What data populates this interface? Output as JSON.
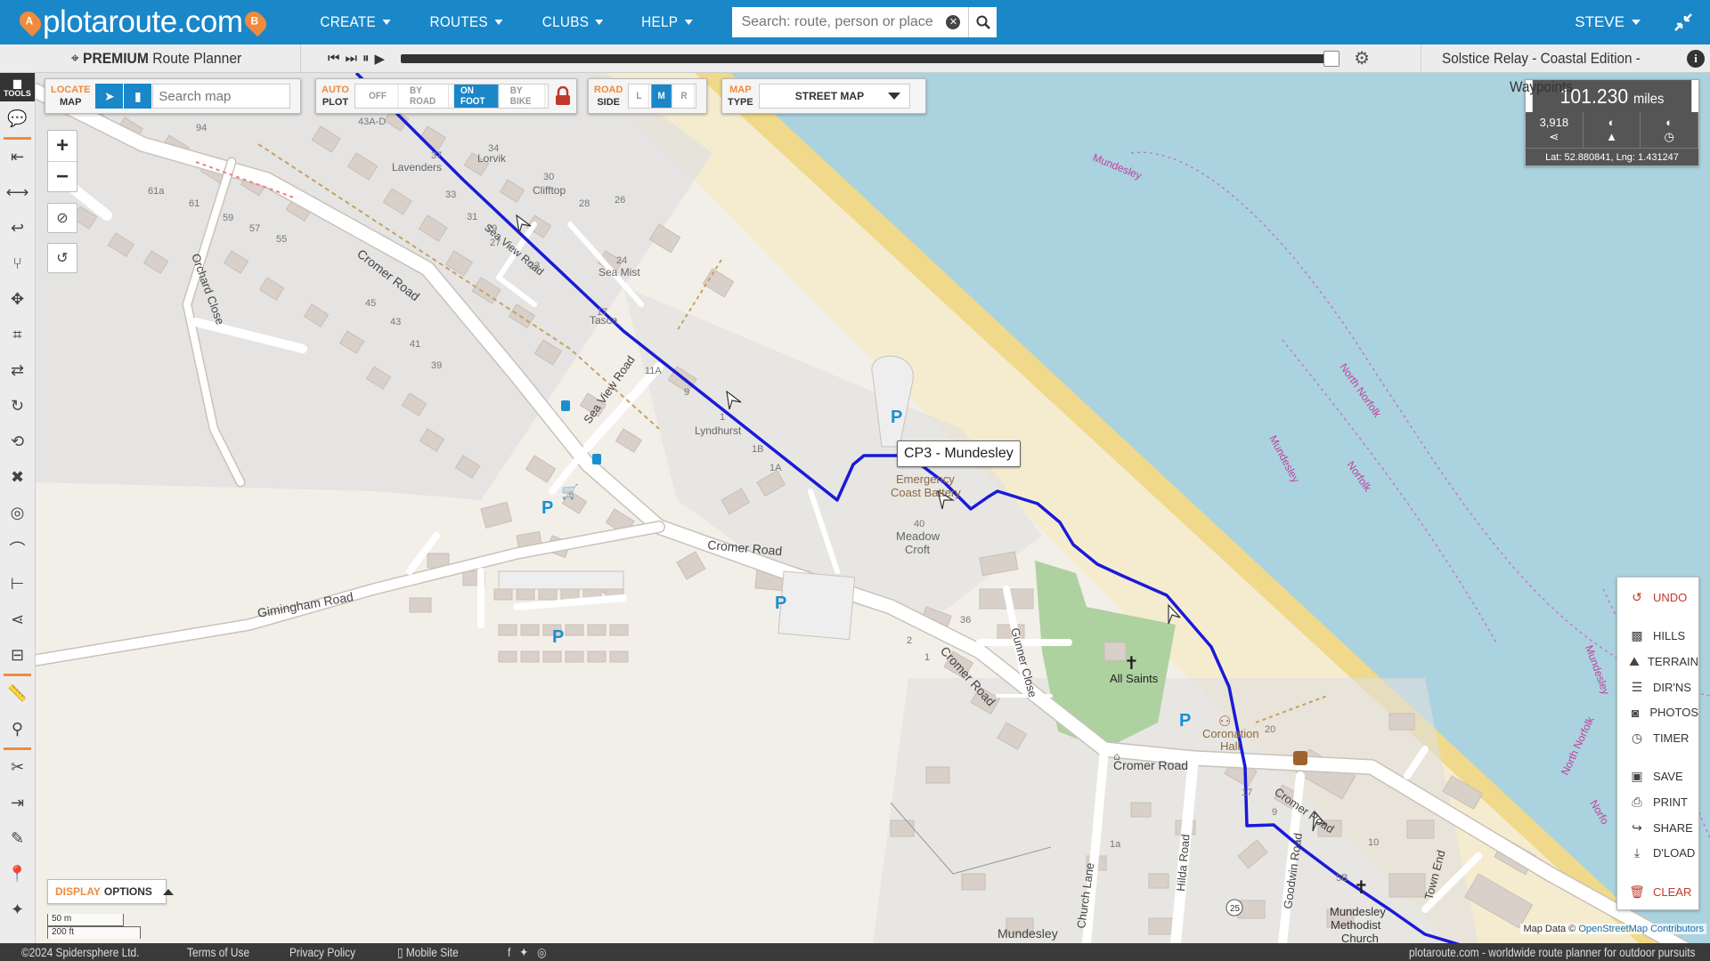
{
  "topbar": {
    "logo_text": "plotaroute.com",
    "pin_a": "A",
    "pin_b": "B",
    "menu": [
      {
        "label": "CREATE"
      },
      {
        "label": "ROUTES"
      },
      {
        "label": "CLUBS"
      },
      {
        "label": "HELP"
      }
    ],
    "search_placeholder": "Search: route, person or place",
    "user": "STEVE"
  },
  "subbar": {
    "planner_bold": "PREMIUM",
    "planner_rest": " Route Planner",
    "route_name": "Solstice Relay - Coastal Edition - Waypoints",
    "progress": 1.0
  },
  "tools": {
    "header": "TOOLS"
  },
  "locate": {
    "label1": "LOCATE",
    "label2": "MAP",
    "search_placeholder": "Search map"
  },
  "autoplot": {
    "label1": "AUTO",
    "label2": "PLOT",
    "options": [
      {
        "label": "OFF",
        "on": false
      },
      {
        "label": "BY ROAD",
        "on": false
      },
      {
        "label": "ON FOOT",
        "on": true
      },
      {
        "label": "BY BIKE",
        "on": false
      }
    ]
  },
  "roadside": {
    "label1": "ROAD",
    "label2": "SIDE",
    "options": [
      {
        "label": "L",
        "on": false
      },
      {
        "label": "M",
        "on": true
      },
      {
        "label": "R",
        "on": false
      }
    ]
  },
  "maptype": {
    "label1": "MAP",
    "label2": "TYPE",
    "selected": "STREET MAP"
  },
  "distance": {
    "value": "101.230",
    "unit": "miles",
    "count": "3,918",
    "latlng": "Lat: 52.880841, Lng: 1.431247"
  },
  "actions": [
    {
      "label": "UNDO",
      "icon": "undo-icon"
    },
    {
      "label": "HILLS",
      "icon": "hills-icon"
    },
    {
      "label": "TERRAIN",
      "icon": "terrain-icon"
    },
    {
      "label": "DIR'NS",
      "icon": "directions-icon"
    },
    {
      "label": "PHOTOS",
      "icon": "camera-icon"
    },
    {
      "label": "TIMER",
      "icon": "timer-icon"
    },
    {
      "label": "SAVE",
      "icon": "save-icon"
    },
    {
      "label": "PRINT",
      "icon": "print-icon"
    },
    {
      "label": "SHARE",
      "icon": "share-icon"
    },
    {
      "label": "D'LOAD",
      "icon": "download-icon"
    },
    {
      "label": "CLEAR",
      "icon": "trash-icon"
    }
  ],
  "display_options": {
    "orange": "DISPLAY",
    "rest": "OPTIONS"
  },
  "scale": {
    "metric": "50 m",
    "imperial": "200 ft"
  },
  "attribution": {
    "prefix": "Map Data ©",
    "link": "OpenStreetMap Contributors"
  },
  "checkpoint": "CP3 - Mundesley",
  "map_labels": {
    "roads": [
      "Cromer Road",
      "Cromer Road",
      "Cromer Road",
      "Cromer Road",
      "Cromer Road",
      "Gimingham Road",
      "Orchard Close",
      "Sea View Road",
      "Sea View Road",
      "Gunner Close",
      "Hilda Road",
      "Church Lane",
      "Goodwin Road",
      "Town End",
      "Mundesley"
    ],
    "places": [
      "Lavenders",
      "Lorvik",
      "Clifftop",
      "Sea Mist",
      "Tasca",
      "Lyndhurst",
      "Emergency",
      "Coast Battery",
      "Meadow",
      "Croft",
      "All Saints",
      "Coronation",
      "Hall",
      "Mundesley",
      "Methodist",
      "Church"
    ],
    "houses": [
      "94",
      "61a",
      "61",
      "59",
      "57",
      "55",
      "45",
      "43",
      "41",
      "39",
      "37",
      "34",
      "33",
      "31",
      "30",
      "29",
      "28",
      "27",
      "26",
      "24",
      "23",
      "17",
      "11A",
      "9",
      "1",
      "1B",
      "1A",
      "40",
      "36",
      "2",
      "1",
      "20",
      "17",
      "9",
      "10",
      "5B",
      "1a",
      "43A-D",
      "25"
    ],
    "sea": [
      "Mundesley",
      "North Norfolk",
      "Norfolk",
      "Mundesley",
      "Mundesley",
      "North Norfolk",
      "Norfo"
    ]
  },
  "footer": {
    "copyright": "©2024 Spidersphere Ltd.",
    "terms": "Terms of Use",
    "privacy": "Privacy Policy",
    "mobile": "Mobile Site",
    "tagline": "plotaroute.com - worldwide route planner for outdoor pursuits"
  }
}
